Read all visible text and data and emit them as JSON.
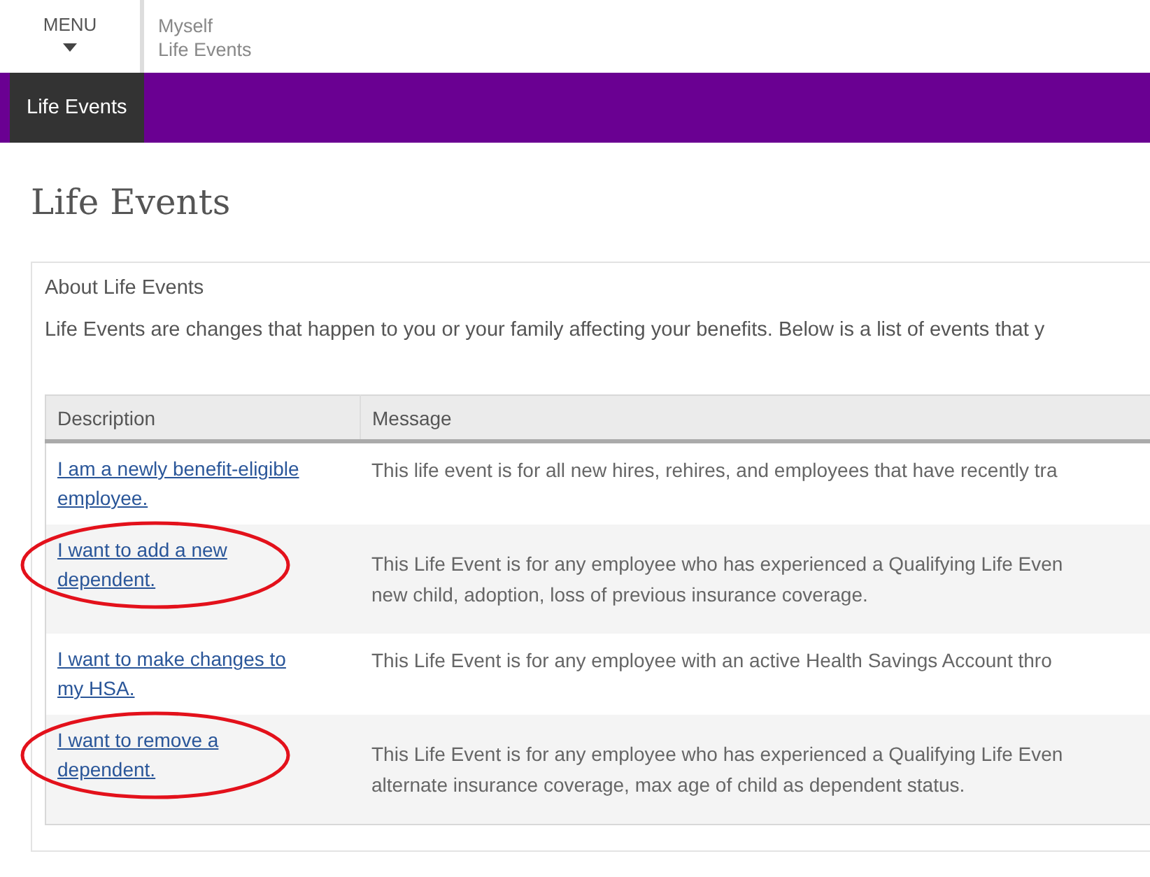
{
  "header": {
    "menu_label": "MENU",
    "breadcrumb": [
      "Myself",
      "Life Events"
    ]
  },
  "nav": {
    "tabs": [
      {
        "label": "Life Events",
        "selected": true
      }
    ]
  },
  "page_title": "Life Events",
  "panel": {
    "heading": "About Life Events",
    "intro": "Life Events are changes that happen to you or your family affecting your benefits. Below is a list of events that y"
  },
  "table": {
    "columns": [
      "Description",
      "Message"
    ],
    "rows": [
      {
        "link": "I am a newly benefit-eligible employee.",
        "message": [
          "This life event is for all new hires, rehires, and employees that have recently tra"
        ],
        "circled": false
      },
      {
        "link": "I want to add a new dependent.",
        "message": [
          "This Life Event is for any employee who has experienced a Qualifying Life Even",
          "new child, adoption, loss of previous insurance coverage."
        ],
        "circled": true
      },
      {
        "link": "I want to make changes to my HSA.",
        "message": [
          "This Life Event is for any employee with an active Health Savings Account thro"
        ],
        "circled": false
      },
      {
        "link": "I want to remove a dependent.",
        "message": [
          "This Life Event is for any employee who has experienced a Qualifying Life Even",
          "alternate insurance coverage, max age of child as dependent status."
        ],
        "circled": true
      }
    ]
  }
}
